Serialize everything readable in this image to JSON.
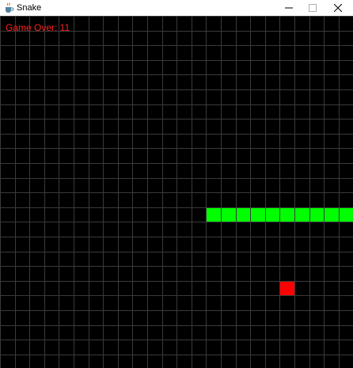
{
  "window": {
    "title": "Snake"
  },
  "titlebar_icons": {
    "app": "java-cup-icon",
    "minimize": "minimize-icon",
    "maximize": "maximize-icon",
    "close": "close-icon"
  },
  "game": {
    "status_text": "Game Over: 11",
    "grid_columns": 24,
    "grid_rows": 24,
    "colors": {
      "background": "#000000",
      "grid_line": "#3a3a3a",
      "snake": "#00ff00",
      "food": "#ff0000",
      "status_text": "#ff2020"
    },
    "snake_segments": [
      {
        "col": 14,
        "row": 13
      },
      {
        "col": 15,
        "row": 13
      },
      {
        "col": 16,
        "row": 13
      },
      {
        "col": 17,
        "row": 13
      },
      {
        "col": 18,
        "row": 13
      },
      {
        "col": 19,
        "row": 13
      },
      {
        "col": 20,
        "row": 13
      },
      {
        "col": 21,
        "row": 13
      },
      {
        "col": 22,
        "row": 13
      },
      {
        "col": 23,
        "row": 13
      }
    ],
    "food": {
      "col": 19,
      "row": 18
    }
  }
}
